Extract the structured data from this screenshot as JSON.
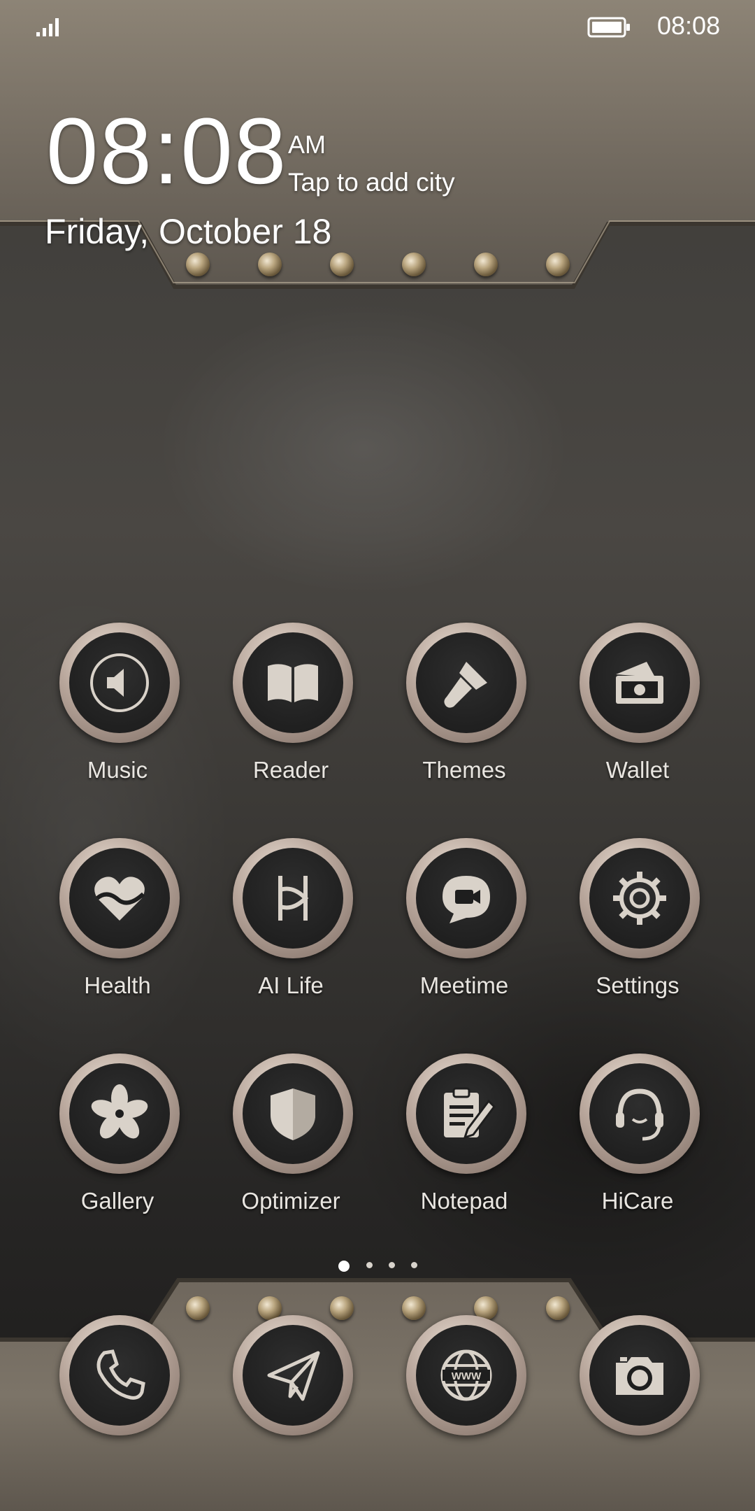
{
  "status_bar": {
    "time": "08:08",
    "signal_icon": "signal-bars-icon",
    "battery_icon": "battery-icon"
  },
  "clock_widget": {
    "time": "08:08",
    "ampm": "AM",
    "city_prompt": "Tap to add city",
    "date": "Friday, October 18"
  },
  "apps": [
    {
      "label": "Music",
      "icon": "speaker-icon"
    },
    {
      "label": "Reader",
      "icon": "book-icon"
    },
    {
      "label": "Themes",
      "icon": "paintbrush-icon"
    },
    {
      "label": "Wallet",
      "icon": "wallet-icon"
    },
    {
      "label": "Health",
      "icon": "heart-icon"
    },
    {
      "label": "AI Life",
      "icon": "ai-life-icon"
    },
    {
      "label": "Meetime",
      "icon": "video-chat-icon"
    },
    {
      "label": "Settings",
      "icon": "gear-icon"
    },
    {
      "label": "Gallery",
      "icon": "flower-icon"
    },
    {
      "label": "Optimizer",
      "icon": "shield-icon"
    },
    {
      "label": "Notepad",
      "icon": "notepad-icon"
    },
    {
      "label": "HiCare",
      "icon": "headset-icon"
    }
  ],
  "dock": [
    {
      "name": "phone",
      "icon": "phone-icon"
    },
    {
      "name": "messages",
      "icon": "paper-plane-icon"
    },
    {
      "name": "browser",
      "icon": "globe-www-icon"
    },
    {
      "name": "camera",
      "icon": "camera-icon"
    }
  ],
  "page_indicator": {
    "pages": 4,
    "active": 0
  },
  "colors": {
    "icon_fill": "#d9d2c9",
    "ring": "#b7a59a",
    "label": "#e9e6e1"
  }
}
